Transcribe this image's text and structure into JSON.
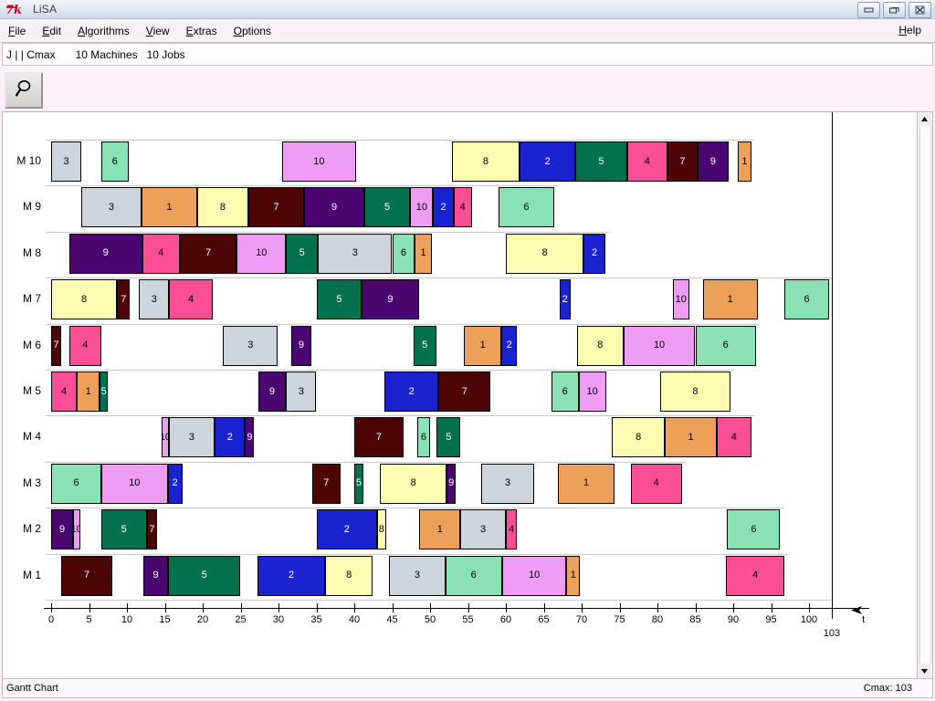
{
  "window": {
    "title": "LiSA",
    "logo_icon": "tk-logo-icon",
    "buttons": {
      "minimize": "minimize-icon",
      "maximize": "maximize-icon",
      "close": "close-icon"
    }
  },
  "menu": {
    "items": [
      {
        "label": "File",
        "accel": "F"
      },
      {
        "label": "Edit",
        "accel": "E"
      },
      {
        "label": "Algorithms",
        "accel": "A"
      },
      {
        "label": "View",
        "accel": "V"
      },
      {
        "label": "Extras",
        "accel": "E"
      },
      {
        "label": "Options",
        "accel": "O"
      }
    ],
    "help": {
      "label": "Help",
      "accel": "H"
    }
  },
  "problem_info": {
    "notation": "J | | Cmax",
    "machines": "10 Machines",
    "jobs": "10 Jobs"
  },
  "toolbar": {
    "zoom_button": "magnifier-icon"
  },
  "ruler": {
    "ticks": [
      "0",
      "5",
      "10",
      "15",
      "20",
      "25",
      "30",
      "35",
      "40",
      "45",
      "50",
      "55",
      "60",
      "65",
      "70",
      "75",
      "80",
      "85",
      "90",
      "95",
      "100"
    ],
    "cmax_marker": "103"
  },
  "status": {
    "left": "Gantt Chart",
    "right": "Cmax: 103"
  },
  "axis": {
    "t_label": "t",
    "cmax_label": "103",
    "ticks": [
      "0",
      "5",
      "10",
      "15",
      "20",
      "25",
      "30",
      "35",
      "40",
      "45",
      "50",
      "55",
      "60",
      "65",
      "70",
      "75",
      "80",
      "85",
      "90",
      "95",
      "100"
    ]
  },
  "colors": {
    "job1": "#eda05a",
    "job2": "#1a22cf",
    "job3": "#ccd4dc",
    "job4": "#fc4e94",
    "job5": "#00714c",
    "job6": "#89e2b4",
    "job7": "#4c0404",
    "job8": "#fbfbb2",
    "job9": "#4b0571",
    "job10": "#ef9cf4"
  },
  "chart_data": {
    "type": "gantt",
    "title": "Gantt Chart",
    "xlabel": "t",
    "xlim": [
      0,
      103
    ],
    "cmax": 103,
    "machine_label_prefix": "M",
    "machines": [
      {
        "name": "M 10",
        "tasks": [
          {
            "job": "3",
            "start": 0,
            "end": 4,
            "color": "job3"
          },
          {
            "job": "6",
            "start": 6.6,
            "end": 10.2,
            "color": "job6"
          },
          {
            "job": "10",
            "start": 30.5,
            "end": 40.2,
            "color": "job10"
          },
          {
            "job": "8",
            "start": 52.9,
            "end": 61.8,
            "color": "job8"
          },
          {
            "job": "2",
            "start": 61.8,
            "end": 69.2,
            "color": "job2"
          },
          {
            "job": "5",
            "start": 69.2,
            "end": 76.0,
            "color": "job5"
          },
          {
            "job": "4",
            "start": 76.0,
            "end": 81.3,
            "color": "job4"
          },
          {
            "job": "7",
            "start": 81.3,
            "end": 85.3,
            "color": "job7"
          },
          {
            "job": "9",
            "start": 85.3,
            "end": 89.4,
            "color": "job9"
          },
          {
            "job": "1",
            "start": 90.6,
            "end": 92.4,
            "color": "job1"
          }
        ]
      },
      {
        "name": "M 9",
        "tasks": [
          {
            "job": "3",
            "start": 4.0,
            "end": 11.9,
            "color": "job3"
          },
          {
            "job": "1",
            "start": 11.9,
            "end": 19.3,
            "color": "job1"
          },
          {
            "job": "8",
            "start": 19.3,
            "end": 26.0,
            "color": "job8"
          },
          {
            "job": "7",
            "start": 26.0,
            "end": 33.4,
            "color": "job7"
          },
          {
            "job": "9",
            "start": 33.4,
            "end": 41.3,
            "color": "job9"
          },
          {
            "job": "5",
            "start": 41.3,
            "end": 47.4,
            "color": "job5"
          },
          {
            "job": "10",
            "start": 47.4,
            "end": 50.4,
            "color": "job10"
          },
          {
            "job": "2",
            "start": 50.4,
            "end": 53.1,
            "color": "job2"
          },
          {
            "job": "4",
            "start": 53.1,
            "end": 55.5,
            "color": "job4"
          },
          {
            "job": "6",
            "start": 59.0,
            "end": 66.4,
            "color": "job6"
          }
        ]
      },
      {
        "name": "M 8",
        "tasks": [
          {
            "job": "9",
            "start": 2.4,
            "end": 12.0,
            "color": "job9"
          },
          {
            "job": "4",
            "start": 12.0,
            "end": 17.0,
            "color": "job4"
          },
          {
            "job": "7",
            "start": 17.0,
            "end": 24.5,
            "color": "job7"
          },
          {
            "job": "10",
            "start": 24.5,
            "end": 31.0,
            "color": "job10"
          },
          {
            "job": "5",
            "start": 31.0,
            "end": 35.2,
            "color": "job5"
          },
          {
            "job": "3",
            "start": 35.2,
            "end": 45.0,
            "color": "job3"
          },
          {
            "job": "6",
            "start": 45.0,
            "end": 48.0,
            "color": "job6"
          },
          {
            "job": "1",
            "start": 48.0,
            "end": 50.2,
            "color": "job1"
          },
          {
            "job": "8",
            "start": 60.0,
            "end": 70.3,
            "color": "job8"
          },
          {
            "job": "2",
            "start": 70.3,
            "end": 73.1,
            "color": "job2"
          }
        ]
      },
      {
        "name": "M 7",
        "tasks": [
          {
            "job": "8",
            "start": 0,
            "end": 8.7,
            "color": "job8"
          },
          {
            "job": "7",
            "start": 8.7,
            "end": 10.4,
            "color": "job7"
          },
          {
            "job": "3",
            "start": 11.6,
            "end": 15.6,
            "color": "job3"
          },
          {
            "job": "4",
            "start": 15.6,
            "end": 21.3,
            "color": "job4"
          },
          {
            "job": "5",
            "start": 35.0,
            "end": 41.0,
            "color": "job5"
          },
          {
            "job": "9",
            "start": 41.0,
            "end": 48.5,
            "color": "job9"
          },
          {
            "job": "2",
            "start": 67.1,
            "end": 68.5,
            "color": "job2"
          },
          {
            "job": "10",
            "start": 82.0,
            "end": 84.2,
            "color": "job10"
          },
          {
            "job": "1",
            "start": 86.0,
            "end": 93.2,
            "color": "job1"
          },
          {
            "job": "6",
            "start": 96.8,
            "end": 102.6,
            "color": "job6"
          }
        ]
      },
      {
        "name": "M 6",
        "tasks": [
          {
            "job": "7",
            "start": 0,
            "end": 1.3,
            "color": "job7"
          },
          {
            "job": "4",
            "start": 2.4,
            "end": 6.6,
            "color": "job4"
          },
          {
            "job": "3",
            "start": 22.7,
            "end": 29.9,
            "color": "job3"
          },
          {
            "job": "9",
            "start": 31.7,
            "end": 34.3,
            "color": "job9"
          },
          {
            "job": "5",
            "start": 47.8,
            "end": 50.8,
            "color": "job5"
          },
          {
            "job": "1",
            "start": 54.5,
            "end": 59.4,
            "color": "job1"
          },
          {
            "job": "2",
            "start": 59.4,
            "end": 61.5,
            "color": "job2"
          },
          {
            "job": "8",
            "start": 69.4,
            "end": 75.5,
            "color": "job8"
          },
          {
            "job": "10",
            "start": 75.5,
            "end": 85.0,
            "color": "job10"
          },
          {
            "job": "6",
            "start": 85.0,
            "end": 93.0,
            "color": "job6"
          }
        ]
      },
      {
        "name": "M 5",
        "tasks": [
          {
            "job": "4",
            "start": 0,
            "end": 3.4,
            "color": "job4"
          },
          {
            "job": "1",
            "start": 3.4,
            "end": 6.4,
            "color": "job1"
          },
          {
            "job": "5",
            "start": 6.4,
            "end": 7.5,
            "color": "job5"
          },
          {
            "job": "9",
            "start": 27.3,
            "end": 31.0,
            "color": "job9"
          },
          {
            "job": "3",
            "start": 31.0,
            "end": 35.0,
            "color": "job3"
          },
          {
            "job": "2",
            "start": 44.0,
            "end": 51.1,
            "color": "job2"
          },
          {
            "job": "7",
            "start": 51.1,
            "end": 58.0,
            "color": "job7"
          },
          {
            "job": "6",
            "start": 66.0,
            "end": 69.6,
            "color": "job6"
          },
          {
            "job": "10",
            "start": 69.6,
            "end": 73.2,
            "color": "job10"
          },
          {
            "job": "8",
            "start": 80.4,
            "end": 89.6,
            "color": "job8"
          }
        ]
      },
      {
        "name": "M 4",
        "tasks": [
          {
            "job": "10",
            "start": 14.6,
            "end": 15.5,
            "color": "job10"
          },
          {
            "job": "3",
            "start": 15.5,
            "end": 21.6,
            "color": "job3"
          },
          {
            "job": "2",
            "start": 21.6,
            "end": 25.6,
            "color": "job2"
          },
          {
            "job": "9",
            "start": 25.6,
            "end": 26.8,
            "color": "job9"
          },
          {
            "job": "7",
            "start": 40.0,
            "end": 46.5,
            "color": "job7"
          },
          {
            "job": "6",
            "start": 48.3,
            "end": 50.0,
            "color": "job6"
          },
          {
            "job": "5",
            "start": 50.9,
            "end": 54.0,
            "color": "job5"
          },
          {
            "job": "8",
            "start": 74.0,
            "end": 81.0,
            "color": "job8"
          },
          {
            "job": "1",
            "start": 81.0,
            "end": 87.8,
            "color": "job1"
          },
          {
            "job": "4",
            "start": 87.8,
            "end": 92.4,
            "color": "job4"
          }
        ]
      },
      {
        "name": "M 3",
        "tasks": [
          {
            "job": "6",
            "start": 0,
            "end": 6.6,
            "color": "job6"
          },
          {
            "job": "10",
            "start": 6.6,
            "end": 15.4,
            "color": "job10"
          },
          {
            "job": "2",
            "start": 15.4,
            "end": 17.3,
            "color": "job2"
          },
          {
            "job": "7",
            "start": 34.4,
            "end": 38.2,
            "color": "job7"
          },
          {
            "job": "5",
            "start": 40.0,
            "end": 41.2,
            "color": "job5"
          },
          {
            "job": "8",
            "start": 43.4,
            "end": 52.2,
            "color": "job8"
          },
          {
            "job": "9",
            "start": 52.2,
            "end": 53.4,
            "color": "job9"
          },
          {
            "job": "3",
            "start": 56.8,
            "end": 63.7,
            "color": "job3"
          },
          {
            "job": "1",
            "start": 66.9,
            "end": 74.3,
            "color": "job1"
          },
          {
            "job": "4",
            "start": 76.5,
            "end": 83.2,
            "color": "job4"
          }
        ]
      },
      {
        "name": "M 2",
        "tasks": [
          {
            "job": "9",
            "start": 0,
            "end": 2.9,
            "color": "job9"
          },
          {
            "job": "10",
            "start": 2.9,
            "end": 3.8,
            "color": "job10"
          },
          {
            "job": "5",
            "start": 6.6,
            "end": 12.6,
            "color": "job5"
          },
          {
            "job": "7",
            "start": 12.6,
            "end": 14.0,
            "color": "job7"
          },
          {
            "job": "2",
            "start": 35.0,
            "end": 43.0,
            "color": "job2"
          },
          {
            "job": "8",
            "start": 43.0,
            "end": 44.2,
            "color": "job8"
          },
          {
            "job": "1",
            "start": 48.6,
            "end": 54.0,
            "color": "job1"
          },
          {
            "job": "3",
            "start": 54.0,
            "end": 60.0,
            "color": "job3"
          },
          {
            "job": "4",
            "start": 60.0,
            "end": 61.5,
            "color": "job4"
          },
          {
            "job": "6",
            "start": 89.2,
            "end": 96.2,
            "color": "job6"
          }
        ]
      },
      {
        "name": "M 1",
        "tasks": [
          {
            "job": "7",
            "start": 1.3,
            "end": 8.1,
            "color": "job7"
          },
          {
            "job": "9",
            "start": 12.2,
            "end": 15.4,
            "color": "job9"
          },
          {
            "job": "5",
            "start": 15.4,
            "end": 25.0,
            "color": "job5"
          },
          {
            "job": "2",
            "start": 27.2,
            "end": 36.2,
            "color": "job2"
          },
          {
            "job": "8",
            "start": 36.2,
            "end": 42.4,
            "color": "job8"
          },
          {
            "job": "3",
            "start": 44.6,
            "end": 52.0,
            "color": "job3"
          },
          {
            "job": "6",
            "start": 52.0,
            "end": 59.5,
            "color": "job6"
          },
          {
            "job": "10",
            "start": 59.5,
            "end": 68.0,
            "color": "job10"
          },
          {
            "job": "1",
            "start": 68.0,
            "end": 69.8,
            "color": "job1"
          },
          {
            "job": "4",
            "start": 89.0,
            "end": 96.8,
            "color": "job4"
          }
        ]
      }
    ]
  }
}
